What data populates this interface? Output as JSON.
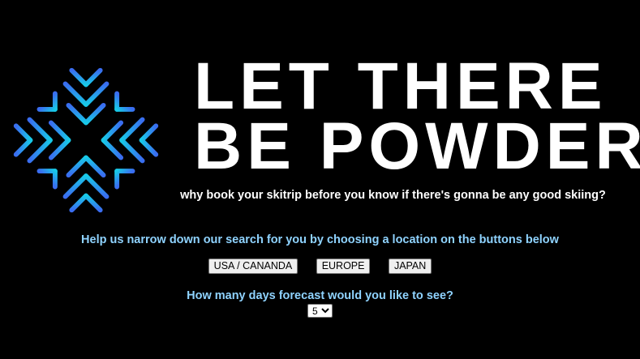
{
  "logo": {
    "icon": "snowflake-icon",
    "gradient": [
      "#3a6df0",
      "#18c9e8"
    ]
  },
  "header": {
    "title_line1": "LET THERE",
    "title_line2": "BE POWDER",
    "tagline": "why book your skitrip before you know if there's gonna be any good skiing?"
  },
  "locations": {
    "prompt": "Help us narrow down our search for you by choosing a location on the buttons below",
    "buttons": [
      "USA / CANANDA",
      "EUROPE",
      "JAPAN"
    ]
  },
  "forecast": {
    "prompt": "How many days forecast would you like to see?",
    "selected": "5"
  },
  "colors": {
    "background": "#000000",
    "title": "#ffffff",
    "prompt": "#8fd3ff"
  }
}
